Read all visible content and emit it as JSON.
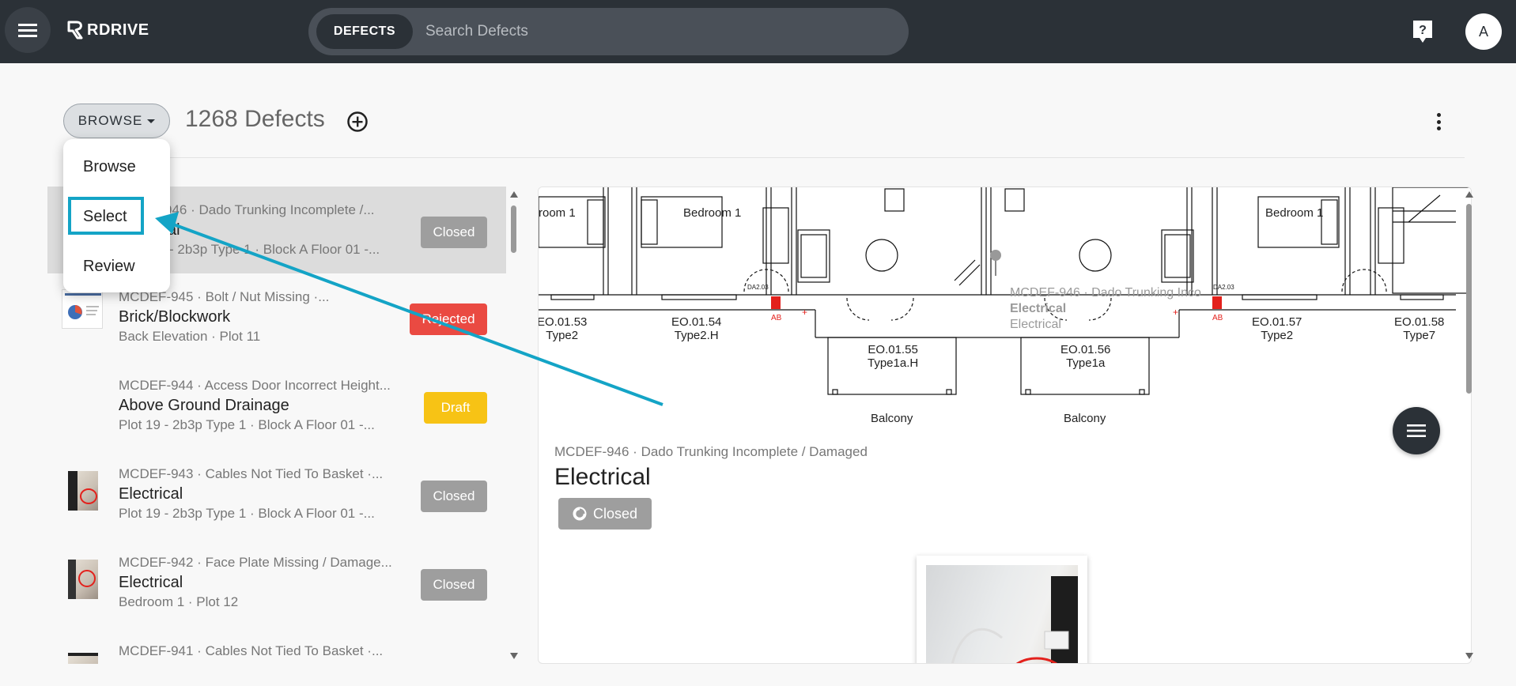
{
  "app": {
    "logo_text": "RDRIVE",
    "search_chip": "DEFECTS",
    "search_placeholder": "Search Defects",
    "avatar_initial": "A"
  },
  "toolbar": {
    "browse_label": "BROWSE",
    "count_label": "1268 Defects"
  },
  "dropdown": {
    "items": [
      "Browse",
      "Select",
      "Review"
    ],
    "highlighted": "Select"
  },
  "list": {
    "items": [
      {
        "ref": "MCDEF-946 · Dado Trunking Incomplete /...",
        "ref_visible": "946 · Dado Trunking Incomplete /...",
        "title": "Electrical",
        "title_visible": "al",
        "location": "Plot 19 - 2b3p Type 1 · Block A Floor 01 -...",
        "location_visible": "- 2b3p Type 1 · Block A Floor 01 -...",
        "status": "Closed",
        "selected": true
      },
      {
        "ref": "MCDEF-945 · Bolt / Nut Missing ·...",
        "title": "Brick/Blockwork",
        "location": "Back Elevation · Plot 11",
        "status": "Rejected"
      },
      {
        "ref": "MCDEF-944 · Access Door Incorrect Height...",
        "title": "Above Ground Drainage",
        "location": "Plot 19 - 2b3p Type 1 · Block A Floor 01 -...",
        "status": "Draft"
      },
      {
        "ref": "MCDEF-943 · Cables Not Tied To Basket ·...",
        "title": "Electrical",
        "location": "Plot 19 - 2b3p Type 1 · Block A Floor 01 -...",
        "status": "Closed"
      },
      {
        "ref": "MCDEF-942 · Face Plate Missing / Damage...",
        "title": "Electrical",
        "location": "Bedroom 1 · Plot 12",
        "status": "Closed"
      },
      {
        "ref": "MCDEF-941 · Cables Not Tied To Basket ·...",
        "title": "",
        "location": "",
        "status": ""
      }
    ]
  },
  "detail": {
    "ref": "MCDEF-946 · Dado Trunking Incomplete / Damaged",
    "title": "Electrical",
    "status": "Closed",
    "plan": {
      "rooms": [
        "Bedroom 1",
        "Bedroom 1",
        "Bedroom 1"
      ],
      "room_clipped": "room 1",
      "units": [
        {
          "code": "EO.01.53",
          "type": "Type2"
        },
        {
          "code": "EO.01.54",
          "type": "Type2.H"
        },
        {
          "code": "EO.01.55",
          "type": "Type1a.H"
        },
        {
          "code": "EO.01.56",
          "type": "Type1a"
        },
        {
          "code": "EO.01.57",
          "type": "Type2"
        },
        {
          "code": "EO.01.58",
          "type": "Type7"
        }
      ],
      "balconies": [
        "Balcony",
        "Balcony"
      ],
      "door_tags": [
        "DA2.03",
        "DA2.03"
      ],
      "ab_markers": [
        "AB",
        "AB"
      ],
      "pin_popup": {
        "ref": "MCDEF-946 · Dado Trunking Inco",
        "title": "Electrical",
        "sub": "Electrical"
      }
    }
  },
  "colors": {
    "topbar": "#2b3137",
    "highlight": "#14a4c6",
    "closed": "#9e9e9e",
    "rejected": "#ea4a42",
    "draft": "#f7c315"
  }
}
